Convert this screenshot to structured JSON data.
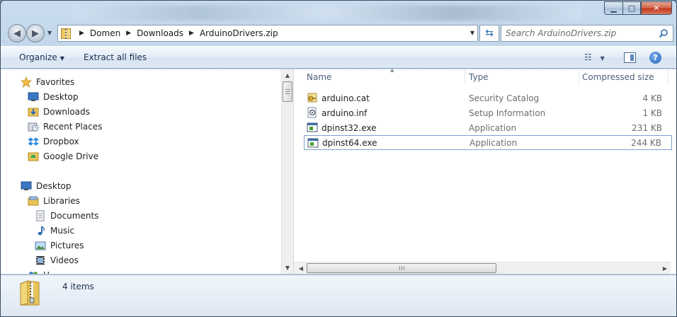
{
  "window": {
    "controls": {
      "minimize": "▁",
      "maximize": "□",
      "close": "✕"
    }
  },
  "nav": {
    "back_glyph": "◀",
    "forward_glyph": "▶",
    "breadcrumbs": [
      "Domen",
      "Downloads",
      "ArduinoDrivers.zip"
    ],
    "search_placeholder": "Search ArduinoDrivers.zip"
  },
  "toolbar": {
    "organize_label": "Organize",
    "extract_label": "Extract all files"
  },
  "sidebar": {
    "favorites_label": "Favorites",
    "favorites": [
      "Desktop",
      "Downloads",
      "Recent Places",
      "Dropbox",
      "Google Drive"
    ],
    "desktop_label": "Desktop",
    "libraries_label": "Libraries",
    "libraries": [
      "Documents",
      "Music",
      "Pictures",
      "Videos"
    ],
    "partial_item": "H"
  },
  "file_list": {
    "columns": [
      "Name",
      "Type",
      "Compressed size"
    ],
    "rows": [
      {
        "name": "arduino.cat",
        "type": "Security Catalog",
        "size": "4 KB",
        "icon": "catalog-icon"
      },
      {
        "name": "arduino.inf",
        "type": "Setup Information",
        "size": "1 KB",
        "icon": "setup-info-icon"
      },
      {
        "name": "dpinst32.exe",
        "type": "Application",
        "size": "231 KB",
        "icon": "application-icon"
      },
      {
        "name": "dpinst64.exe",
        "type": "Application",
        "size": "244 KB",
        "icon": "application-icon",
        "selected": true
      }
    ]
  },
  "details": {
    "item_count": "4 items"
  },
  "colors": {
    "accent": "#2f6bb3",
    "selection_border": "#7da2ce",
    "close_button": "#c2391c"
  }
}
